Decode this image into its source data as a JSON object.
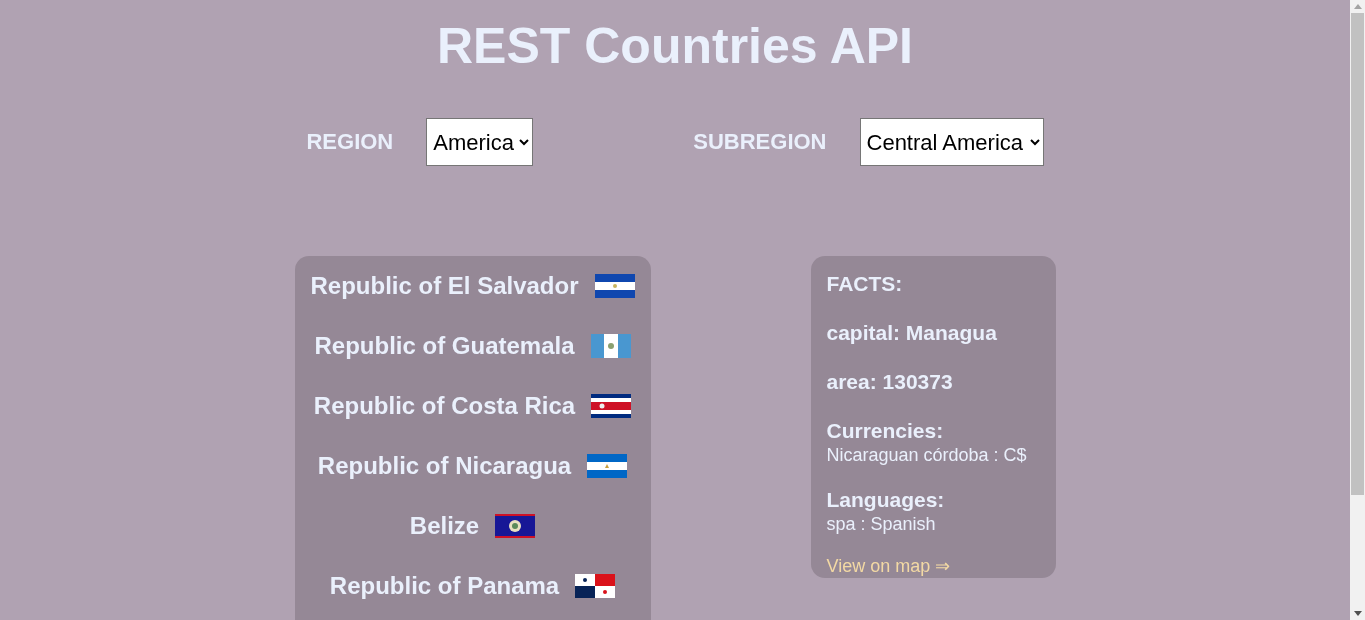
{
  "title": "REST Countries API",
  "filters": [
    {
      "label": "REGION",
      "value": "America"
    },
    {
      "label": "SUBREGION",
      "value": "Central America"
    }
  ],
  "countries": [
    {
      "name": "Republic of El Salvador"
    },
    {
      "name": "Republic of Guatemala"
    },
    {
      "name": "Republic of Costa Rica"
    },
    {
      "name": "Republic of Nicaragua"
    },
    {
      "name": "Belize"
    },
    {
      "name": "Republic of Panama"
    }
  ],
  "facts": {
    "heading": "FACTS:",
    "capital": "capital: Managua",
    "area": "area: 130373",
    "currencies_heading": "Currencies:",
    "currencies": "Nicaraguan córdoba : C$",
    "languages_heading": "Languages:",
    "languages": "spa : Spanish",
    "link": "View on map ⇒"
  }
}
